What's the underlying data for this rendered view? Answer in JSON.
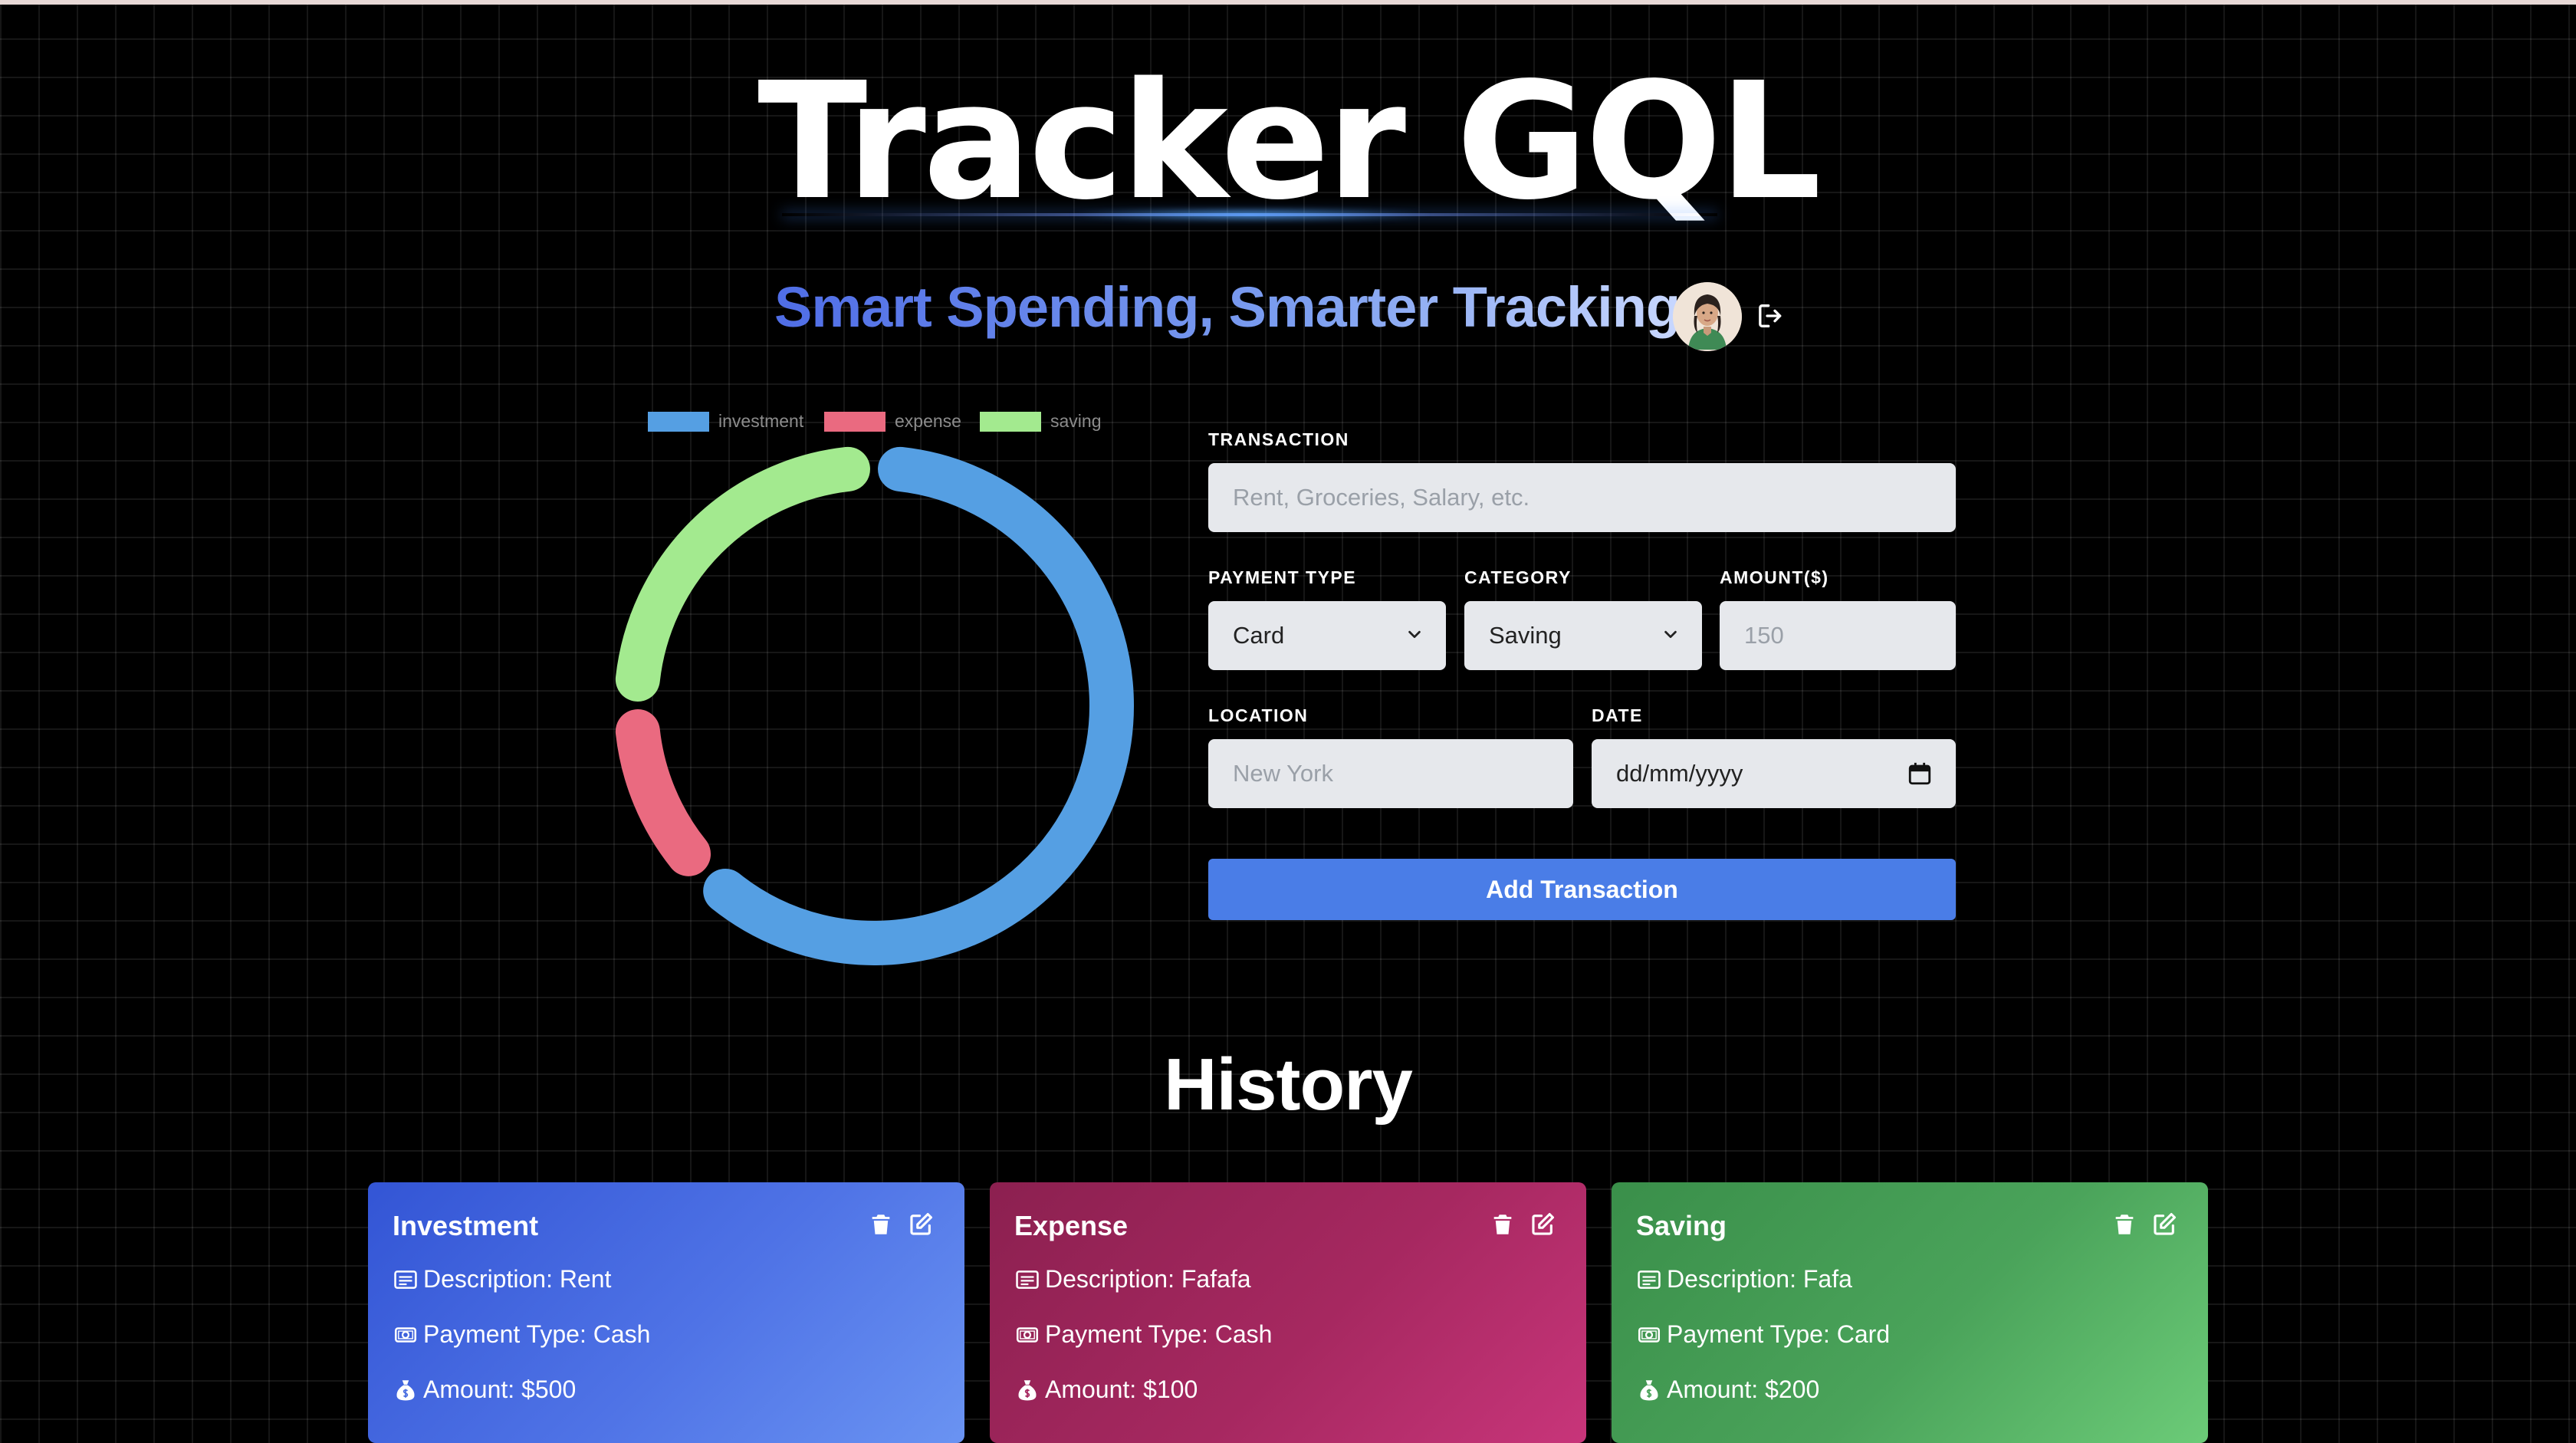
{
  "app": {
    "title": "Tracker GQL",
    "subtitle": "Smart Spending, Smarter Tracking"
  },
  "chart_data": {
    "type": "pie",
    "variant": "doughnut",
    "categories": [
      "investment",
      "expense",
      "saving"
    ],
    "values": [
      500,
      100,
      200
    ],
    "colors": [
      "#559fe3",
      "#ea6a80",
      "#a3ea8f"
    ],
    "legend_position": "top"
  },
  "form": {
    "transaction_label": "TRANSACTION",
    "transaction_placeholder": "Rent, Groceries, Salary, etc.",
    "payment_type_label": "PAYMENT TYPE",
    "payment_type_value": "Card",
    "category_label": "CATEGORY",
    "category_value": "Saving",
    "amount_label": "AMOUNT($)",
    "amount_placeholder": "150",
    "location_label": "LOCATION",
    "location_placeholder": "New York",
    "date_label": "DATE",
    "date_placeholder": "dd/mm/yyyy",
    "submit_label": "Add Transaction"
  },
  "history": {
    "title": "History",
    "cards": [
      {
        "category": "Investment",
        "description": "Description: Rent",
        "payment": "Payment Type: Cash",
        "amount": "Amount: $500",
        "color": "#4a6ee0"
      },
      {
        "category": "Expense",
        "description": "Description: Fafafa",
        "payment": "Payment Type: Cash",
        "amount": "Amount: $100",
        "color": "#a62860"
      },
      {
        "category": "Saving",
        "description": "Description: Fafa",
        "payment": "Payment Type: Card",
        "amount": "Amount: $200",
        "color": "#4aa35a"
      }
    ]
  }
}
